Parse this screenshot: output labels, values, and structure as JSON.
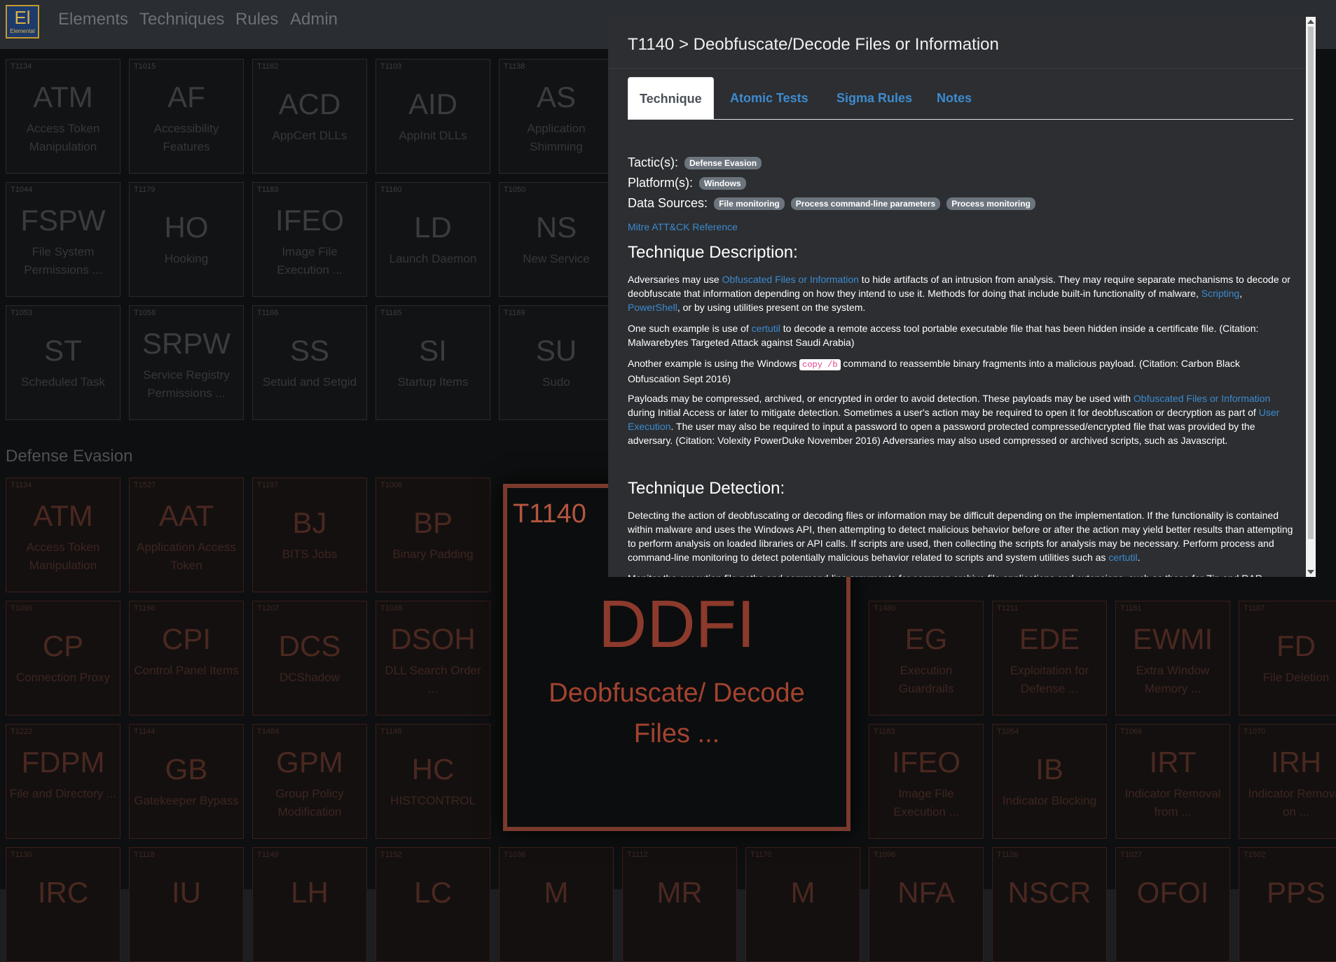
{
  "nav": {
    "logo_big": "El",
    "logo_small": "Elemental",
    "items": [
      "Elements",
      "Techniques",
      "Rules",
      "Admin"
    ]
  },
  "grid": {
    "rows1": [
      [
        {
          "id": "T1134",
          "abbr": "ATM",
          "name": "Access Token Manipulation"
        },
        {
          "id": "T1015",
          "abbr": "AF",
          "name": "Accessibility Features"
        },
        {
          "id": "T1182",
          "abbr": "ACD",
          "name": "AppCert DLLs"
        },
        {
          "id": "T1103",
          "abbr": "AID",
          "name": "AppInit DLLs"
        },
        {
          "id": "T1138",
          "abbr": "AS",
          "name": "Application Shimming"
        }
      ],
      [
        {
          "id": "T1044",
          "abbr": "FSPW",
          "name": "File System Permissions ..."
        },
        {
          "id": "T1179",
          "abbr": "HO",
          "name": "Hooking"
        },
        {
          "id": "T1183",
          "abbr": "IFEO",
          "name": "Image File Execution ..."
        },
        {
          "id": "T1160",
          "abbr": "LD",
          "name": "Launch Daemon"
        },
        {
          "id": "T1050",
          "abbr": "NS",
          "name": "New Service"
        }
      ],
      [
        {
          "id": "T1053",
          "abbr": "ST",
          "name": "Scheduled Task"
        },
        {
          "id": "T1058",
          "abbr": "SRPW",
          "name": "Service Registry Permissions ..."
        },
        {
          "id": "T1166",
          "abbr": "SS",
          "name": "Setuid and Setgid"
        },
        {
          "id": "T1165",
          "abbr": "SI",
          "name": "Startup Items"
        },
        {
          "id": "T1169",
          "abbr": "SU",
          "name": "Sudo"
        }
      ]
    ],
    "section_title": "Defense Evasion",
    "rows2": [
      [
        {
          "id": "T1134",
          "abbr": "ATM",
          "name": "Access Token Manipulation"
        },
        {
          "id": "T1527",
          "abbr": "AAT",
          "name": "Application Access Token"
        },
        {
          "id": "T1197",
          "abbr": "BJ",
          "name": "BITS Jobs"
        },
        {
          "id": "T1009",
          "abbr": "BP",
          "name": "Binary Padding"
        }
      ],
      [
        {
          "id": "T1090",
          "abbr": "CP",
          "name": "Connection Proxy"
        },
        {
          "id": "T1196",
          "abbr": "CPI",
          "name": "Control Panel Items"
        },
        {
          "id": "T1207",
          "abbr": "DCS",
          "name": "DCShadow"
        },
        {
          "id": "T1038",
          "abbr": "DSOH",
          "name": "DLL Search Order ..."
        }
      ],
      [
        {
          "id": "T1222",
          "abbr": "FDPM",
          "name": "File and Directory ..."
        },
        {
          "id": "T1144",
          "abbr": "GB",
          "name": "Gatekeeper Bypass"
        },
        {
          "id": "T1484",
          "abbr": "GPM",
          "name": "Group Policy Modification"
        },
        {
          "id": "T1148",
          "abbr": "HC",
          "name": "HISTCONTROL"
        }
      ],
      [
        {
          "id": "T1130",
          "abbr": "IRC",
          "name": ""
        },
        {
          "id": "T1118",
          "abbr": "IU",
          "name": ""
        },
        {
          "id": "T1149",
          "abbr": "LH",
          "name": ""
        },
        {
          "id": "T1152",
          "abbr": "LC",
          "name": ""
        },
        {
          "id": "T1036",
          "abbr": "M",
          "name": ""
        },
        {
          "id": "T1112",
          "abbr": "MR",
          "name": ""
        },
        {
          "id": "T1170",
          "abbr": "M",
          "name": ""
        },
        {
          "id": "T1096",
          "abbr": "NFA",
          "name": ""
        },
        {
          "id": "T1126",
          "abbr": "NSCR",
          "name": ""
        },
        {
          "id": "T1027",
          "abbr": "OFOI",
          "name": ""
        },
        {
          "id": "T1502",
          "abbr": "PPS",
          "name": ""
        }
      ],
      [
        {
          "id": "T1480",
          "abbr": "EG",
          "name": "Execution Guardrails"
        },
        {
          "id": "T1211",
          "abbr": "EDE",
          "name": "Exploitation for Defense ..."
        },
        {
          "id": "T1181",
          "abbr": "EWMI",
          "name": "Extra Window Memory ..."
        },
        {
          "id": "T1107",
          "abbr": "FD",
          "name": "File Deletion"
        }
      ],
      [
        {
          "id": "T1183",
          "abbr": "IFEO",
          "name": "Image File Execution ..."
        },
        {
          "id": "T1054",
          "abbr": "IB",
          "name": "Indicator Blocking"
        },
        {
          "id": "T1066",
          "abbr": "IRT",
          "name": "Indicator Removal from ..."
        },
        {
          "id": "T1070",
          "abbr": "IRH",
          "name": "Indicator Removal on ..."
        }
      ]
    ]
  },
  "highlight": {
    "id": "T1140",
    "abbr": "DDFI",
    "name": "Deobfuscate/ Decode Files ..."
  },
  "modal": {
    "title": "T1140 > Deobfuscate/Decode Files or Information",
    "tabs": [
      "Technique",
      "Atomic Tests",
      "Sigma Rules",
      "Notes"
    ],
    "tactics_label": "Tactic(s):",
    "tactics": [
      "Defense Evasion"
    ],
    "platforms_label": "Platform(s):",
    "platforms": [
      "Windows"
    ],
    "datasources_label": "Data Sources:",
    "datasources": [
      "File monitoring",
      "Process command-line parameters",
      "Process monitoring"
    ],
    "reference_link": "Mitre ATT&CK Reference",
    "desc_heading": "Technique Description:",
    "desc_p1_a": "Adversaries may use ",
    "desc_p1_link1": "Obfuscated Files or Information",
    "desc_p1_b": " to hide artifacts of an intrusion from analysis. They may require separate mechanisms to decode or deobfuscate that information depending on how they intend to use it. Methods for doing that include built-in functionality of malware, ",
    "desc_p1_link2": "Scripting",
    "desc_p1_c": ", ",
    "desc_p1_link3": "PowerShell",
    "desc_p1_d": ", or by using utilities present on the system.",
    "desc_p2_a": "One such example is use of ",
    "desc_p2_link": "certutil",
    "desc_p2_b": " to decode a remote access tool portable executable file that has been hidden inside a certificate file. (Citation: Malwarebytes Targeted Attack against Saudi Arabia)",
    "desc_p3_a": "Another example is using the Windows ",
    "desc_p3_code": "copy /b",
    "desc_p3_b": " command to reassemble binary fragments into a malicious payload. (Citation: Carbon Black Obfuscation Sept 2016)",
    "desc_p4_a": "Payloads may be compressed, archived, or encrypted in order to avoid detection. These payloads may be used with ",
    "desc_p4_link1": "Obfuscated Files or Information",
    "desc_p4_b": " during Initial Access or later to mitigate detection. Sometimes a user's action may be required to open it for deobfuscation or decryption as part of ",
    "desc_p4_link2": "User Execution",
    "desc_p4_c": ". The user may also be required to input a password to open a password protected compressed/encrypted file that was provided by the adversary. (Citation: Volexity PowerDuke November 2016) Adversaries may also used compressed or archived scripts, such as Javascript.",
    "det_heading": "Technique Detection:",
    "det_p1_a": "Detecting the action of deobfuscating or decoding files or information may be difficult depending on the implementation. If the functionality is contained within malware and uses the Windows API, then attempting to detect malicious behavior before or after the action may yield better results than attempting to perform analysis on loaded libraries or API calls. If scripts are used, then collecting the scripts for analysis may be necessary. Perform process and command-line monitoring to detect potentially malicious behavior related to scripts and system utilities such as ",
    "det_p1_link": "certutil",
    "det_p1_b": ".",
    "det_p2": "Monitor the execution file paths and command-line arguments for common archive file applications and extensions, such as those for Zip and RAR archive tools, and correlate with other suspicious behavior to reduce false positives from normal user and administrator behavior."
  }
}
